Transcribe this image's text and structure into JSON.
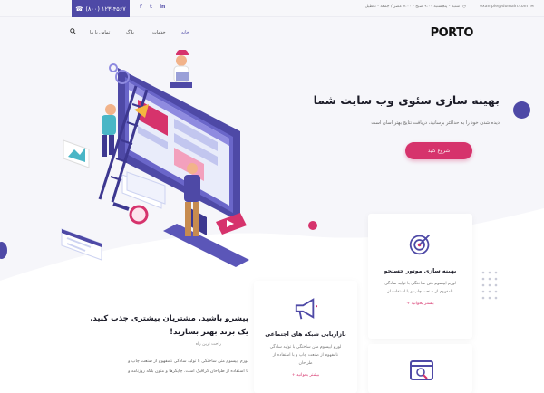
{
  "colors": {
    "primary": "#4e49a6",
    "accent": "#d6336c"
  },
  "topbar": {
    "phone": "(۸۰۰) ۱۲۳-۴۵۶۷",
    "phone_icon": "phone-icon",
    "social": [
      "f",
      "t",
      "in"
    ],
    "hours": "شنبه - پنجشنبه ۹:۰۰ صبح - ۷:۰۰ عصر / جمعه - تعطیل",
    "email": "example@domain.com"
  },
  "nav": {
    "logo": "PORTO",
    "items": [
      "خانه",
      "خدمات",
      "بلاگ",
      "تماس با ما"
    ]
  },
  "hero": {
    "title": "بهینه سازی سئوی وب سایت شما",
    "subtitle": "دیده شدن خود را به حداکثر برسانید، دریافت نتایج بهتر آسان است",
    "button": "شروع کنید"
  },
  "cards": [
    {
      "title": "بهینه سازی موتور جستجو",
      "text": [
        "لورم ایپسوم متن ساختگی با تولید سادگی",
        "نامفهوم از صنعت چاپ و با استفاده از"
      ],
      "link": "بیشتر بخوانید +",
      "icon": "target-icon"
    },
    {
      "title": "بازاریابی شبکه های اجتماعی",
      "text": [
        "لورم ایپسوم متن ساختگی با تولید سادگی",
        "نامفهوم از صنعت چاپ و با استفاده از",
        "طراحان"
      ],
      "link": "بیشتر بخوانید +",
      "icon": "megaphone-icon"
    },
    {
      "icon": "search-window-icon"
    }
  ],
  "bottom": {
    "title_line1": "پیشرو باشید. مشتریان بیشتری جذب کنید.",
    "title_line2": "یک برند بهتر بسازید!",
    "sub": "راحت ترین راه",
    "text_line1": "لورم ایپسوم متن ساختگی با تولید سادگی نامفهوم از صنعت چاپ و",
    "text_line2": "با استفاده از طراحان گرافیک است. چاپگرها و متون بلکه روزنامه و"
  }
}
